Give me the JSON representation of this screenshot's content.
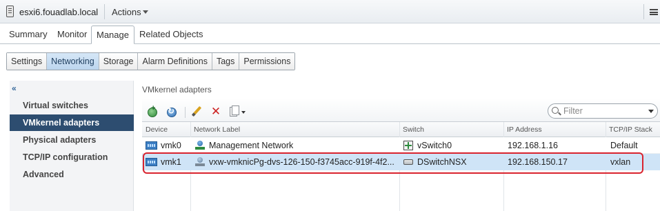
{
  "header": {
    "host_name": "esxi6.fouadlab.local",
    "actions_label": "Actions",
    "host_icon": "host-icon",
    "menu_icon": "menu-icon"
  },
  "main_tabs": [
    "Summary",
    "Monitor",
    "Manage",
    "Related Objects"
  ],
  "main_tabs_active": "Manage",
  "sub_tabs": [
    "Settings",
    "Networking",
    "Storage",
    "Alarm Definitions",
    "Tags",
    "Permissions"
  ],
  "sub_tabs_active": "Networking",
  "left_nav": {
    "collapse_icon": "«",
    "items": [
      "Virtual switches",
      "VMkernel adapters",
      "Physical adapters",
      "TCP/IP configuration",
      "Advanced"
    ],
    "active": "VMkernel adapters"
  },
  "panel": {
    "title": "VMkernel adapters",
    "toolbar_icons": [
      "add-network-icon",
      "refresh-network-icon",
      "edit-pencil-icon",
      "remove-x-icon",
      "more-actions-icon"
    ],
    "filter_placeholder": "Filter"
  },
  "table": {
    "columns": [
      "Device",
      "Network Label",
      "Switch",
      "IP Address",
      "TCP/IP Stack"
    ],
    "rows": [
      {
        "device": "vmk0",
        "network_label": "Management Network",
        "switch": "vSwitch0",
        "ip_address": "192.168.1.16",
        "tcpip_stack": "Default"
      },
      {
        "device": "vmk1",
        "network_label": "vxw-vmknicPg-dvs-126-150-f3745acc-919f-4f2...",
        "switch": "DSwitchNSX",
        "ip_address": "192.168.150.17",
        "tcpip_stack": "vxlan"
      }
    ],
    "selected_row": 1
  },
  "colors": {
    "nav_active_bg": "#2d4d70",
    "subtab_active_bg": "#bcd5ee",
    "row_selected_bg": "#cfe4f7",
    "highlight_border": "#d9232e"
  }
}
